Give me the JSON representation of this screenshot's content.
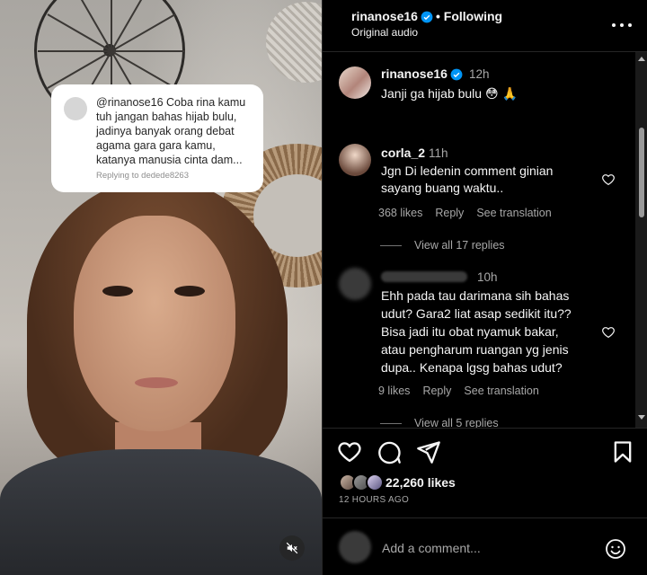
{
  "video": {
    "reply_card": {
      "text": "@rinanose16 Coba rina kamu tuh jangan bahas hijab bulu, jadinya banyak orang debat agama gara gara kamu, katanya manusia cinta dam...",
      "replying_to": "Replying to dedede8263"
    },
    "mute_icon": "speaker-muted-icon"
  },
  "header": {
    "username": "rinanose16",
    "following": "• Following",
    "audio": "Original audio"
  },
  "caption": {
    "username": "rinanose16",
    "time": "12h",
    "text": "Janji ga hijab bulu 😳 🙏"
  },
  "comments": [
    {
      "username": "corla_2",
      "time": "11h",
      "text": [
        "Jgn Di ledenin comment ginian",
        "sayang buang waktu.."
      ],
      "likes": "368 likes",
      "reply": "Reply",
      "translate": "See translation",
      "view_replies": "View all 17 replies"
    },
    {
      "username": "",
      "time": "10h",
      "text": [
        "Ehh pada tau darimana sih bahas",
        "udut? Gara2 liat asap sedikit itu??",
        "Bisa jadi itu obat nyamuk bakar,",
        "atau pengharum ruangan yg jenis",
        "dupa.. Kenapa lgsg bahas udut?"
      ],
      "likes": "9 likes",
      "reply": "Reply",
      "translate": "See translation",
      "view_replies": "View all 5 replies"
    }
  ],
  "actions": {
    "likes": "22,260 likes",
    "ago": "12 HOURS AGO"
  },
  "composer": {
    "placeholder": "Add a comment..."
  },
  "colors": {
    "background": "#000000",
    "text": "#f5f5f5",
    "secondary": "#a8a8a8",
    "verified": "#0095f6"
  }
}
